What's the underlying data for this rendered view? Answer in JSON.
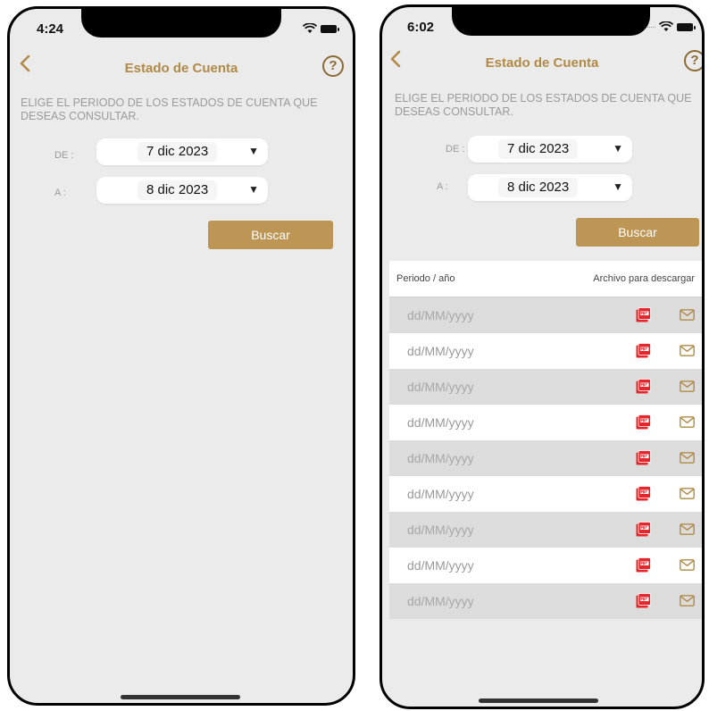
{
  "screens": [
    {
      "status": {
        "time": "4:24"
      },
      "nav": {
        "title": "Estado de Cuenta",
        "help": "?"
      },
      "instruction": "ELIGE EL PERIODO DE LOS ESTADOS DE CUENTA QUE DESEAS CONSULTAR.",
      "from": {
        "label": "DE :",
        "value": "7 dic 2023"
      },
      "to": {
        "label": "A :",
        "value": "8 dic 2023"
      },
      "search_label": "Buscar"
    },
    {
      "status": {
        "time": "6:02"
      },
      "nav": {
        "title": "Estado de Cuenta",
        "help": "?"
      },
      "instruction": "ELIGE EL PERIODO DE LOS ESTADOS DE CUENTA QUE DESEAS CONSULTAR.",
      "from": {
        "label": "DE :",
        "value": "7 dic 2023"
      },
      "to": {
        "label": "A :",
        "value": "8 dic 2023"
      },
      "search_label": "Buscar",
      "table": {
        "columns": [
          "Periodo / año",
          "Archivo para descargar"
        ],
        "rows": [
          "dd/MM/yyyy",
          "dd/MM/yyyy",
          "dd/MM/yyyy",
          "dd/MM/yyyy",
          "dd/MM/yyyy",
          "dd/MM/yyyy",
          "dd/MM/yyyy",
          "dd/MM/yyyy",
          "dd/MM/yyyy"
        ]
      }
    }
  ],
  "icons": {
    "back": "chevron-left-icon",
    "help": "question-circle-icon",
    "dropdown": "triangle-down-icon",
    "pdf": "pdf-icon",
    "mail": "envelope-icon",
    "wifi": "wifi-icon",
    "battery": "battery-icon"
  },
  "colors": {
    "accent": "#b08a46",
    "button": "#bd9554",
    "background": "#ebebeb",
    "pdf_red": "#e3262b"
  }
}
